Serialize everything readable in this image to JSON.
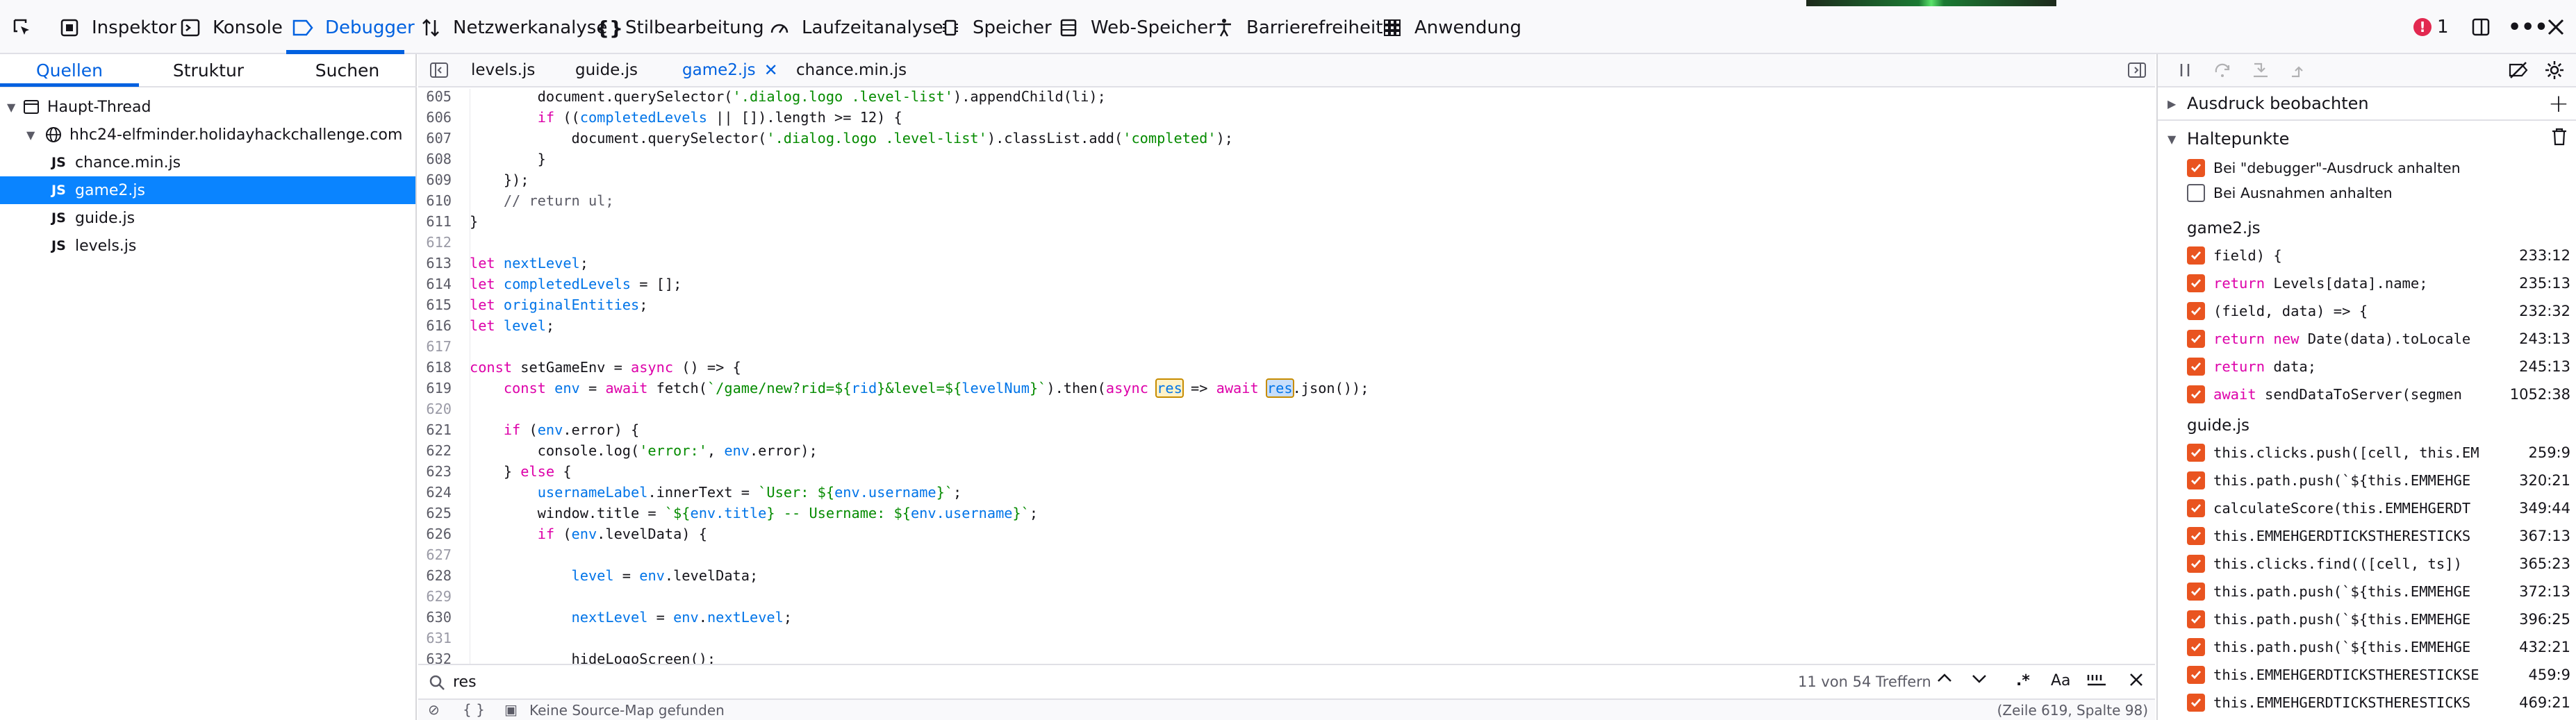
{
  "toolbar": {
    "tabs": [
      "Inspektor",
      "Konsole",
      "Debugger",
      "Netzwerkanalyse",
      "Stilbearbeitung",
      "Laufzeitanalyse",
      "Speicher",
      "Web-Speicher",
      "Barrierefreiheit",
      "Anwendung"
    ],
    "active_tab": "Debugger",
    "error_count": "1"
  },
  "left_panel": {
    "tabs": [
      "Quellen",
      "Struktur",
      "Suchen"
    ],
    "active_tab": "Quellen",
    "thread": "Haupt-Thread",
    "host": "hhc24-elfminder.holidayhackchallenge.com",
    "files": [
      "chance.min.js",
      "game2.js",
      "guide.js",
      "levels.js"
    ],
    "selected_file": "game2.js",
    "badge": "JS"
  },
  "editor": {
    "tabs": [
      "levels.js",
      "guide.js",
      "game2.js",
      "chance.min.js"
    ],
    "active_tab": "game2.js",
    "lines": [
      {
        "n": "605",
        "code": "        document.querySelector('.dialog.logo .level-list').appendChild(li);"
      },
      {
        "n": "606",
        "code": "        if ((completedLevels || []).length >= 12) {"
      },
      {
        "n": "607",
        "code": "            document.querySelector('.dialog.logo .level-list').classList.add('completed');"
      },
      {
        "n": "608",
        "code": "        }"
      },
      {
        "n": "609",
        "code": "    });"
      },
      {
        "n": "610",
        "code": "    // return ul;"
      },
      {
        "n": "611",
        "code": "}"
      },
      {
        "n": "612",
        "code": ""
      },
      {
        "n": "613",
        "code": "let nextLevel;"
      },
      {
        "n": "614",
        "code": "let completedLevels = [];"
      },
      {
        "n": "615",
        "code": "let originalEntities;"
      },
      {
        "n": "616",
        "code": "let level;"
      },
      {
        "n": "617",
        "code": ""
      },
      {
        "n": "618",
        "code": "const setGameEnv = async () => {"
      },
      {
        "n": "619",
        "code": "    const env = await fetch(`/game/new?rid=${rid}&level=${levelNum}`).then(async res => await res.json());"
      },
      {
        "n": "620",
        "code": ""
      },
      {
        "n": "621",
        "code": "    if (env.error) {"
      },
      {
        "n": "622",
        "code": "        console.log('error:', env.error);"
      },
      {
        "n": "623",
        "code": "    } else {"
      },
      {
        "n": "624",
        "code": "        usernameLabel.innerText = `User: ${env.username}`;"
      },
      {
        "n": "625",
        "code": "        window.title = `${env.title} -- Username: ${env.username}`;"
      },
      {
        "n": "626",
        "code": "        if (env.levelData) {"
      },
      {
        "n": "627",
        "code": ""
      },
      {
        "n": "628",
        "code": "            level = env.levelData;"
      },
      {
        "n": "629",
        "code": ""
      },
      {
        "n": "630",
        "code": "            nextLevel = env.nextLevel;"
      },
      {
        "n": "631",
        "code": ""
      },
      {
        "n": "632",
        "code": "            hideLogoScreen();"
      }
    ],
    "search_query": "res",
    "search_count": "11 von 54 Treffern",
    "footer_sourcemap": "Keine Source-Map gefunden",
    "footer_position": "(Zeile 619, Spalte 98)"
  },
  "right_panel": {
    "watch_label": "Ausdruck beobachten",
    "breakpoints_label": "Haltepunkte",
    "pause_options": [
      {
        "label": "Bei \"debugger\"-Ausdruck anhalten",
        "checked": true
      },
      {
        "label": "Bei Ausnahmen anhalten",
        "checked": false
      }
    ],
    "groups": [
      {
        "file": "game2.js",
        "items": [
          {
            "code": "field) {",
            "loc": "233:12"
          },
          {
            "code": "return Levels[data].name;",
            "loc": "235:13"
          },
          {
            "code": "(field, data) => {",
            "loc": "232:32"
          },
          {
            "code": "return new Date(data).toLocale",
            "loc": "243:13"
          },
          {
            "code": "return data;",
            "loc": "245:13"
          },
          {
            "code": "await sendDataToServer(segmen",
            "loc": "1052:38"
          }
        ]
      },
      {
        "file": "guide.js",
        "items": [
          {
            "code": "this.clicks.push([cell, this.EM",
            "loc": "259:9"
          },
          {
            "code": "this.path.push(`${this.EMMEHGE",
            "loc": "320:21"
          },
          {
            "code": "calculateScore(this.EMMEHGERDT",
            "loc": "349:44"
          },
          {
            "code": "this.EMMEHGERDTICKSTHERESTICKS",
            "loc": "367:13"
          },
          {
            "code": "this.clicks.find(([cell, ts])",
            "loc": "365:23"
          },
          {
            "code": "this.path.push(`${this.EMMEHGE",
            "loc": "372:13"
          },
          {
            "code": "this.path.push(`${this.EMMEHGE",
            "loc": "396:25"
          },
          {
            "code": "this.path.push(`${this.EMMEHGE",
            "loc": "432:21"
          },
          {
            "code": "this.EMMEHGERDTICKSTHERESTICKSE",
            "loc": "459:9"
          },
          {
            "code": "this.EMMEHGERDTICKSTHERESTICKS",
            "loc": "469:21"
          }
        ]
      }
    ]
  },
  "colors": {
    "accent": "#0061e0",
    "selection": "#0a84ff",
    "checkbox": "#e95420",
    "keyword": "#dd00a9",
    "variable": "#0074e8",
    "string": "#058b00"
  }
}
